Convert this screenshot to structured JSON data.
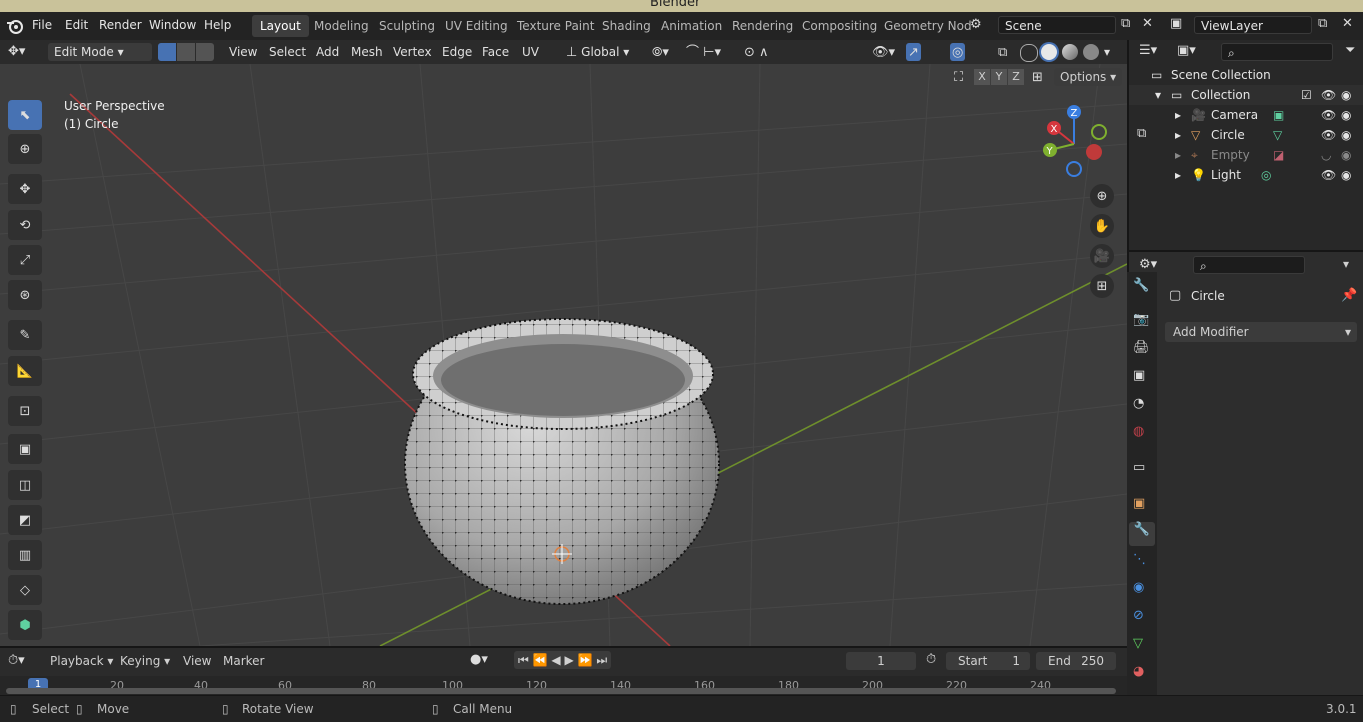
{
  "window_title": "Blender",
  "menu": [
    "File",
    "Edit",
    "Render",
    "Window",
    "Help"
  ],
  "workspaces": [
    "Layout",
    "Modeling",
    "Sculpting",
    "UV Editing",
    "Texture Paint",
    "Shading",
    "Animation",
    "Rendering",
    "Compositing",
    "Geometry Nod"
  ],
  "active_workspace": "Layout",
  "scene_field": "Scene",
  "viewlayer_field": "ViewLayer",
  "viewport_header": {
    "mode": "Edit Mode",
    "menus": [
      "View",
      "Select",
      "Add",
      "Mesh",
      "Vertex",
      "Edge",
      "Face",
      "UV"
    ],
    "transform_orientation": "Global",
    "axes": [
      "X",
      "Y",
      "Z"
    ],
    "options_label": "Options"
  },
  "viewport": {
    "perspective_label": "User Perspective",
    "object_label": "(1) Circle",
    "gizmo_axes": [
      "Z",
      "X",
      "Y"
    ]
  },
  "outliner": {
    "root": "Scene Collection",
    "collection": "Collection",
    "items": [
      {
        "name": "Camera",
        "icon": "camera-icon",
        "visible": true
      },
      {
        "name": "Circle",
        "icon": "mesh-icon",
        "visible": true
      },
      {
        "name": "Empty",
        "icon": "empty-icon",
        "visible": false
      },
      {
        "name": "Light",
        "icon": "light-icon",
        "visible": true
      }
    ]
  },
  "properties": {
    "object_name": "Circle",
    "add_modifier_label": "Add Modifier"
  },
  "timeline": {
    "menus": [
      "Playback",
      "Keying",
      "View",
      "Marker"
    ],
    "current_frame": "1",
    "start_label": "Start",
    "start_value": "1",
    "end_label": "End",
    "end_value": "250",
    "ruler": [
      "1",
      "20",
      "40",
      "60",
      "80",
      "100",
      "120",
      "140",
      "160",
      "180",
      "200",
      "220",
      "240"
    ]
  },
  "status": {
    "select": "Select",
    "move": "Move",
    "rotate": "Rotate View",
    "call_menu": "Call Menu",
    "version": "3.0.1"
  },
  "colors": {
    "accent": "#4772b3",
    "x_axis": "#a73a3a",
    "y_axis": "#6e8f2c",
    "gizmo_x": "#d6363d",
    "gizmo_y": "#7fb02f",
    "gizmo_z": "#3a7ee0"
  }
}
